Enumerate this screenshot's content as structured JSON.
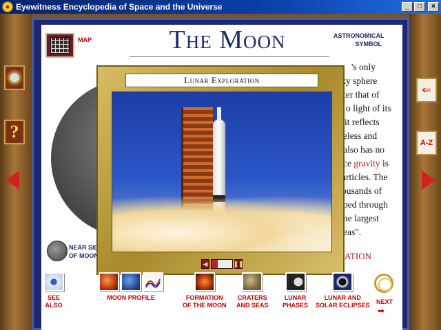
{
  "window": {
    "title": "Eyewitness Encyclopedia of Space and the Universe",
    "minimize": "_",
    "maximize": "□",
    "close": "×"
  },
  "header": {
    "map_label": "MAP",
    "title": "The Moon",
    "astro_label_1": "ASTRONOMICAL",
    "astro_label_2": "SYMBOL"
  },
  "body_text": {
    "lines": [
      "THE MOON IS EARTH'S only",
      "rocky sphere",
      "ter that of",
      "o light of its",
      "it reflects",
      "eless and",
      "also has no",
      "ce",
      "articles. The",
      "ousands of",
      "eped through",
      "he largest",
      "eas\"."
    ],
    "gravity_word": "gravity",
    "line7_suffix": " is",
    "line1_visible": "'s only"
  },
  "near_side": {
    "label_1": "NEAR SIDE",
    "label_2": "OF MOON"
  },
  "lunar_link": "ATION",
  "popup": {
    "title": "Lunar Exploration",
    "progress": 0.3
  },
  "toolbar": {
    "see_also_1": "SEE",
    "see_also_2": "ALSO",
    "moon_profile": "MOON PROFILE",
    "formation_1": "FORMATION",
    "formation_2": "OF THE MOON",
    "craters_1": "CRATERS",
    "craters_2": "AND SEAS",
    "phases_1": "LUNAR",
    "phases_2": "PHASES",
    "eclipses_1": "LUNAR AND",
    "eclipses_2": "SOLAR ECLIPSES",
    "next": "NEXT",
    "next_arrow": "➡"
  },
  "side": {
    "question": "?",
    "az": "A-Z",
    "back": "⇐"
  },
  "icons": {
    "app": "app-icon",
    "map": "map-icon",
    "crescent": "crescent-icon",
    "see_also": "eye-icon",
    "next": "rings-icon"
  }
}
